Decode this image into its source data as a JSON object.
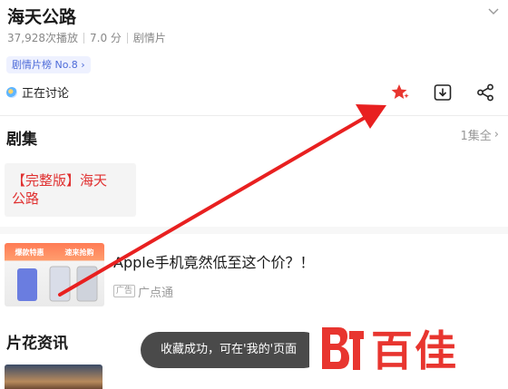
{
  "header": {
    "title": "海天公路",
    "plays": "37,928次播放",
    "score": "7.0 分",
    "genre": "剧情片",
    "rank_chip": "剧情片榜 No.8",
    "discussing": "正在讨论"
  },
  "actions": {
    "favorite_icon": "star-sparkle-icon",
    "download_icon": "download-icon",
    "share_icon": "share-icon",
    "favorite_color": "#e8352f"
  },
  "episodes": {
    "title": "剧集",
    "count": "1集全",
    "items": [
      {
        "label_line1": "【完整版】海天",
        "label_line2": "公路"
      }
    ]
  },
  "ad": {
    "banner_left": "爆款特惠",
    "banner_right": "速来抢购",
    "title": "Apple手机竟然低至这个价？！",
    "badge": "广告",
    "source": "广点通"
  },
  "news": {
    "title": "片花资讯"
  },
  "toast": {
    "text": "收藏成功，可在'我的'页面"
  },
  "watermark": {
    "text": "百佳",
    "color": "#e8352f"
  }
}
